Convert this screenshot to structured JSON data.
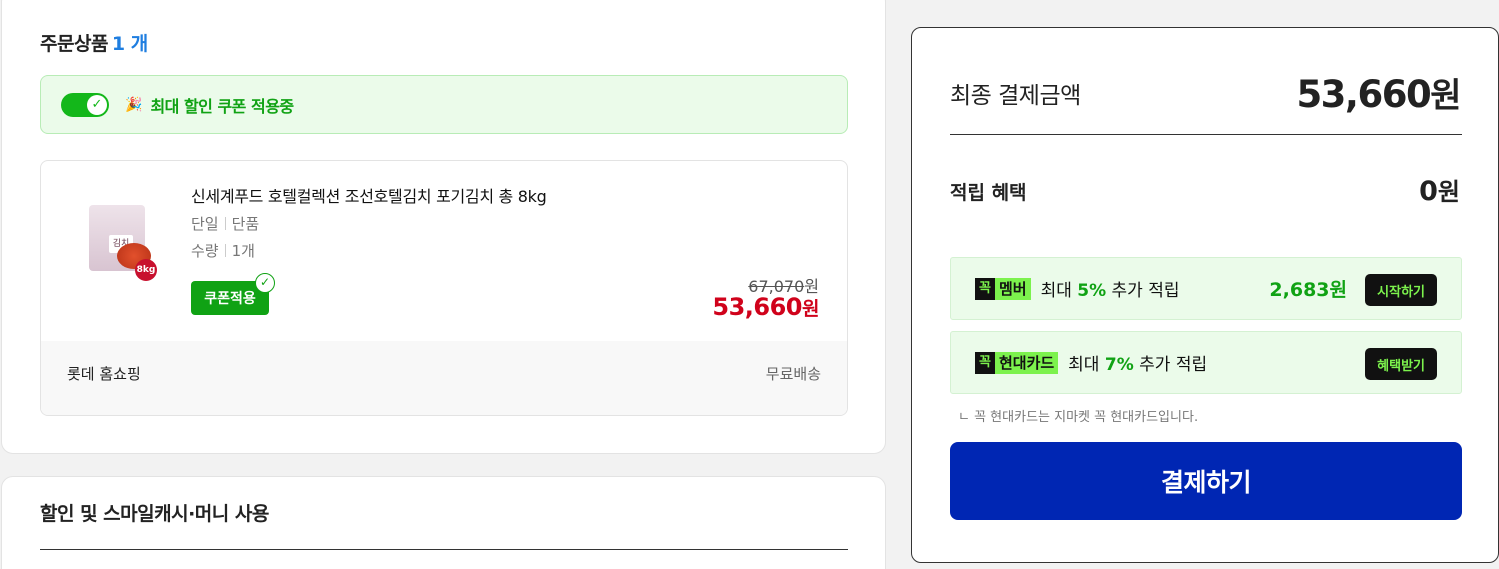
{
  "order": {
    "title": "주문상품",
    "count": "1 개",
    "coupon_banner": "최대 할인 쿠폰 적용중",
    "product": {
      "name": "신세계푸드 호텔컬렉션 조선호텔김치 포기김치 총 8kg",
      "opt_label1": "단일",
      "opt_value1": "단품",
      "opt_label2": "수량",
      "opt_value2": "1개",
      "coupon_tag": "쿠폰적용",
      "thumb_bag_text": "김치",
      "thumb_kg": "8kg",
      "original_price": "67,070",
      "sale_price": "53,660",
      "won": "원"
    },
    "seller": "롯데 홈쇼핑",
    "shipping": "무료배송"
  },
  "discount": {
    "title": "할인 및 스마일캐시·머니 사용"
  },
  "payment": {
    "final_label": "최종 결제금액",
    "final_amount": "53,660",
    "won": "원",
    "reward_label": "적립 혜택",
    "reward_amount": "0",
    "promos": [
      {
        "ggok": "꼭",
        "type": "멤버",
        "text_prefix": "최대",
        "pct": "5%",
        "text_suffix": "추가 적립",
        "amount": "2,683원",
        "button": "시작하기"
      },
      {
        "ggok": "꼭",
        "type": "현대카드",
        "text_prefix": "최대",
        "pct": "7%",
        "text_suffix": "추가 적립",
        "amount": "",
        "button": "혜택받기"
      }
    ],
    "card_note": "ㄴ 꼭 현대카드는 지마켓 꼭 현대카드입니다.",
    "pay_button": "결제하기"
  },
  "colors": {
    "accent_green": "#10a214",
    "pay_blue": "#0026b3",
    "sale_red": "#d0021b",
    "count_blue": "#1f7ee0"
  }
}
